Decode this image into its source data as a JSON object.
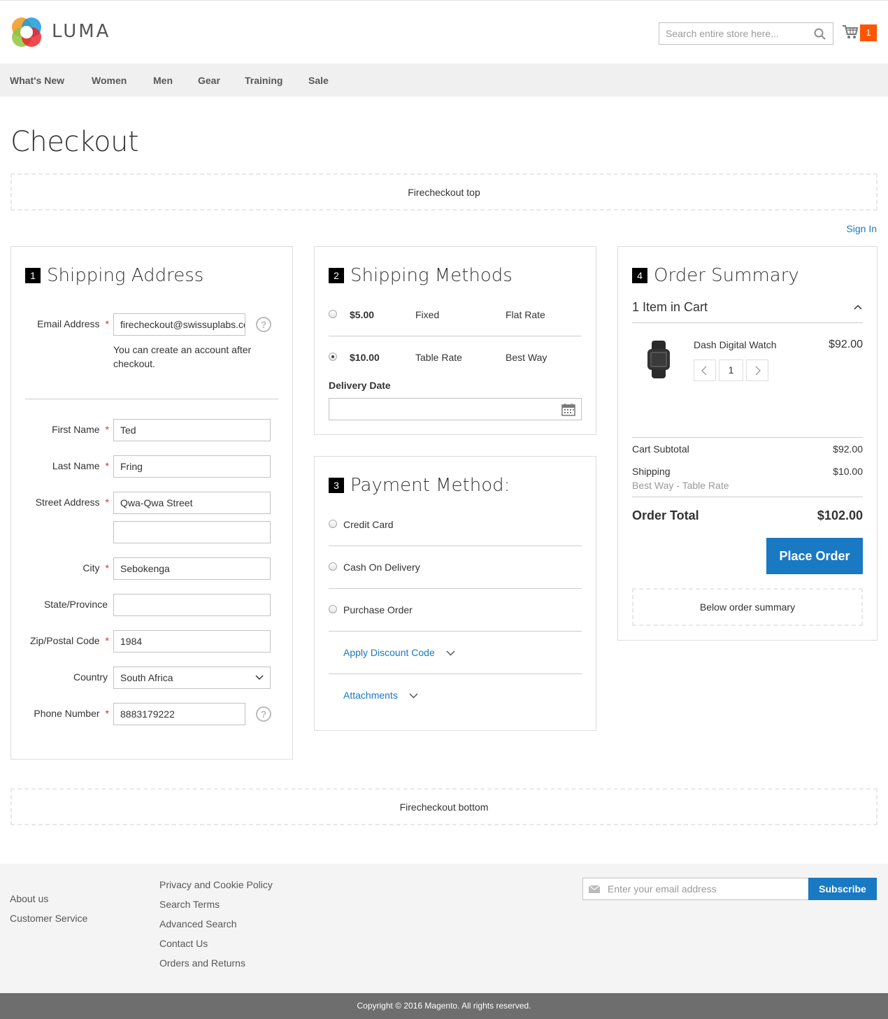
{
  "header": {
    "logo_text": "LUMA",
    "search_placeholder": "Search entire store here...",
    "cart_count": "1"
  },
  "nav": {
    "items": [
      "What's New",
      "Women",
      "Men",
      "Gear",
      "Training",
      "Sale"
    ]
  },
  "page_title": "Checkout",
  "firecheckout_top": "Firecheckout top",
  "firecheckout_bottom": "Firecheckout bottom",
  "sign_in": "Sign In",
  "shipping_address": {
    "step": "1",
    "title": "Shipping Address",
    "email_label": "Email Address",
    "email_value": "firecheckout@swissuplabs.com",
    "account_note": "You can create an account after checkout.",
    "first_name_label": "First Name",
    "first_name_value": "Ted",
    "last_name_label": "Last Name",
    "last_name_value": "Fring",
    "street_label": "Street Address",
    "street_value": "Qwa-Qwa Street",
    "street2_value": "",
    "city_label": "City",
    "city_value": "Sebokenga",
    "state_label": "State/Province",
    "state_value": "",
    "zip_label": "Zip/Postal Code",
    "zip_value": "1984",
    "country_label": "Country",
    "country_value": "South Africa",
    "phone_label": "Phone Number",
    "phone_value": "8883179222",
    "help": "?",
    "required_mark": "*"
  },
  "shipping_methods": {
    "step": "2",
    "title": "Shipping Methods",
    "rates": [
      {
        "price": "$5.00",
        "method": "Fixed",
        "carrier": "Flat Rate",
        "selected": false
      },
      {
        "price": "$10.00",
        "method": "Table Rate",
        "carrier": "Best Way",
        "selected": true
      }
    ],
    "delivery_date_label": "Delivery Date",
    "delivery_date_value": ""
  },
  "payment": {
    "step": "3",
    "title": "Payment Method:",
    "methods": [
      "Credit Card",
      "Cash On Delivery",
      "Purchase Order"
    ],
    "discount_link": "Apply Discount Code",
    "attachments_link": "Attachments"
  },
  "summary": {
    "step": "4",
    "title": "Order Summary",
    "items_in_cart": "1 Item in Cart",
    "product_name": "Dash Digital Watch",
    "product_price": "$92.00",
    "qty": "1",
    "subtotal_label": "Cart Subtotal",
    "subtotal_value": "$92.00",
    "shipping_label": "Shipping",
    "shipping_method": "Best Way - Table Rate",
    "shipping_value": "$10.00",
    "total_label": "Order Total",
    "total_value": "$102.00",
    "place_order": "Place Order",
    "below_summary": "Below order summary"
  },
  "footer": {
    "col1": [
      "About us",
      "Customer Service"
    ],
    "col2": [
      "Privacy and Cookie Policy",
      "Search Terms",
      "Advanced Search",
      "Contact Us",
      "Orders and Returns"
    ],
    "newsletter_placeholder": "Enter your email address",
    "subscribe": "Subscribe",
    "copyright": "Copyright © 2016 Magento. All rights reserved."
  },
  "colors": {
    "accent": "#1979c3",
    "cart_badge": "#ff5501",
    "required": "#e02b27",
    "nav_bg": "#f0f0f0",
    "footer_bg": "#f4f4f4",
    "copyright_bg": "#6e6e6e"
  },
  "icons": {
    "logo": "luma-logo-icon",
    "search": "search-icon",
    "cart": "cart-icon",
    "help": "help-icon",
    "calendar": "calendar-icon",
    "chevron_up": "chevron-up-icon",
    "chevron_down": "chevron-down-icon",
    "qty_decrease": "chevron-left-icon",
    "qty_increase": "chevron-right-icon",
    "envelope": "envelope-icon"
  }
}
